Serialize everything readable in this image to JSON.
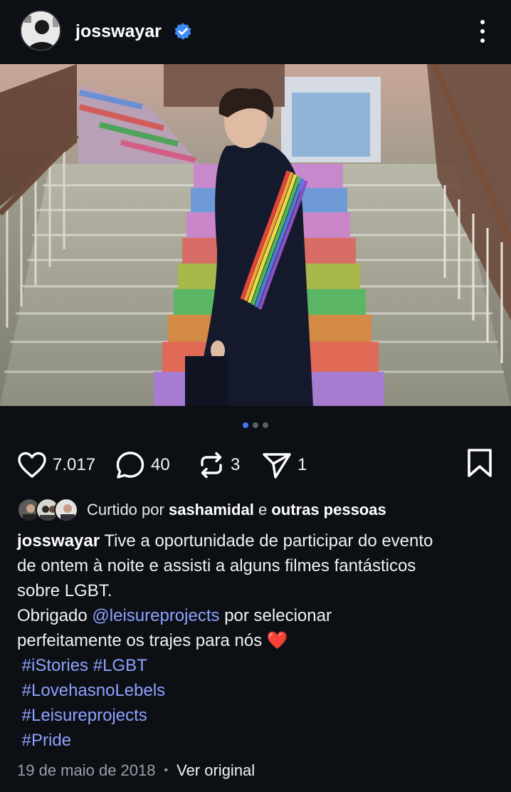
{
  "post": {
    "username": "josswayar",
    "verified": true,
    "carousel": {
      "count": 3,
      "active": 1
    },
    "actions": {
      "likes": "7.017",
      "comments": "40",
      "reposts": "3",
      "shares": "1"
    },
    "liked_by": {
      "prefix": "Curtido por",
      "user": "sashamidal",
      "connector": "e",
      "others": "outras pessoas"
    },
    "caption": {
      "username": "josswayar",
      "line1": "Tive a oportunidade de participar do evento",
      "line2": "de ontem à noite e assisti a alguns filmes fantásticos",
      "line3": "sobre LGBT.",
      "line4_prefix": "Obrigado",
      "mention": "@leisureprojects",
      "line4_suffix": "por selecionar",
      "line5": "perfeitamente os trajes para nós",
      "emoji": "❤️",
      "hashtags_line1": [
        "#iStories",
        "#LGBT"
      ],
      "hashtag2": "#LovehasnoLebels",
      "hashtag3": "#Leisureprojects",
      "hashtag4": "#Pride"
    },
    "date": "19 de maio de 2018",
    "separator": "•",
    "view_original": "Ver original"
  },
  "colors": {
    "background": "#0c0f14",
    "link": "#8ea2ff",
    "verified_badge": "#3d8bf5",
    "active_dot": "#3f7bf3"
  },
  "icons": {
    "like": "heart-icon",
    "comment": "comment-bubble-icon",
    "repost": "repost-icon",
    "share": "send-icon",
    "save": "bookmark-icon",
    "more": "more-vertical-icon",
    "verified": "verified-badge-icon"
  }
}
